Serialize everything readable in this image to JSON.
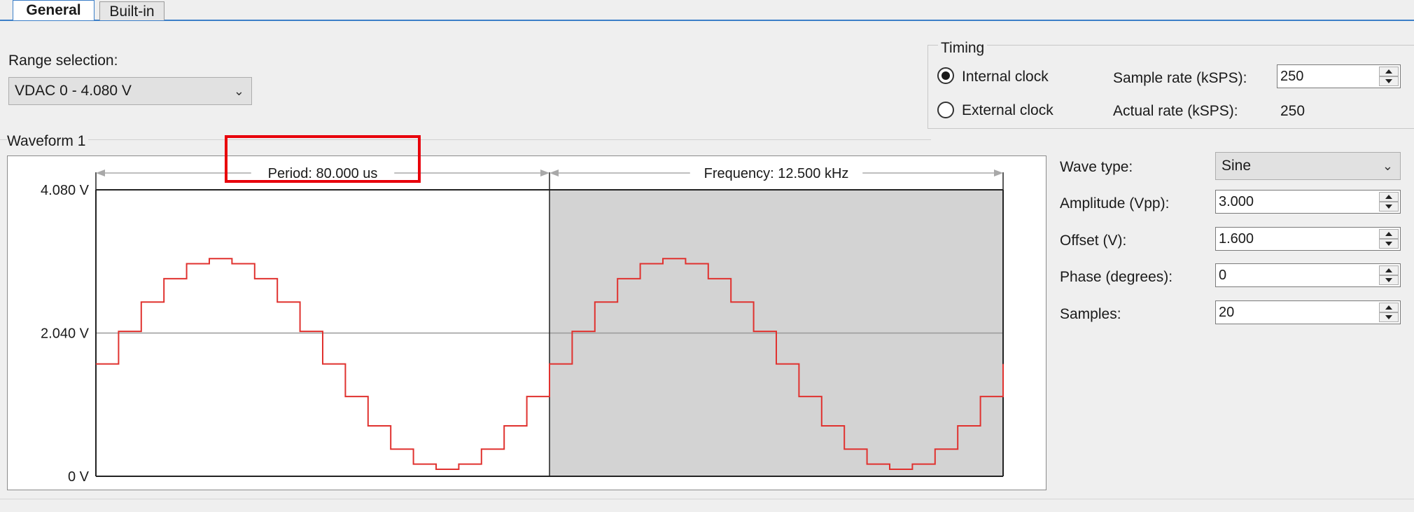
{
  "tabs": [
    {
      "label": "General",
      "active": true
    },
    {
      "label": "Built-in",
      "active": false
    }
  ],
  "range": {
    "label": "Range selection:",
    "selected": "VDAC 0 - 4.080 V"
  },
  "timing": {
    "title": "Timing",
    "internal_clock": "Internal clock",
    "external_clock": "External clock",
    "selected": "Internal clock",
    "sample_rate_label": "Sample rate (kSPS):",
    "sample_rate_value": "250",
    "actual_rate_label": "Actual rate (kSPS):",
    "actual_rate_value": "250"
  },
  "waveform": {
    "title": "Waveform 1",
    "period_label": "Period: 80.000 us",
    "frequency_label": "Frequency: 12.500 kHz",
    "y_ticks": [
      "4.080 V",
      "2.040 V",
      "0 V"
    ],
    "highlight_color": "#e8000b",
    "trace_color": "#e0322f"
  },
  "params": {
    "wave_type_label": "Wave type:",
    "wave_type_value": "Sine",
    "amplitude_label": "Amplitude (Vpp):",
    "amplitude_value": "3.000",
    "offset_label": "Offset (V):",
    "offset_value": "1.600",
    "phase_label": "Phase (degrees):",
    "phase_value": "0",
    "samples_label": "Samples:",
    "samples_value": "20"
  },
  "chart_data": {
    "type": "line",
    "x": [
      0,
      4,
      8,
      12,
      16,
      20,
      24,
      28,
      32,
      36,
      40,
      44,
      48,
      52,
      56,
      60,
      64,
      68,
      72,
      76,
      80,
      84,
      88,
      92,
      96,
      100,
      104,
      108,
      112,
      116,
      120,
      124,
      128,
      132,
      136,
      140,
      144,
      148,
      152,
      156,
      160
    ],
    "values": [
      1.6,
      2.064,
      2.482,
      2.814,
      3.027,
      3.1,
      3.027,
      2.814,
      2.482,
      2.064,
      1.6,
      1.136,
      0.718,
      0.386,
      0.173,
      0.1,
      0.173,
      0.386,
      0.718,
      1.136,
      1.6,
      2.064,
      2.482,
      2.814,
      3.027,
      3.1,
      3.027,
      2.814,
      2.482,
      2.064,
      1.6,
      1.136,
      0.718,
      0.386,
      0.173,
      0.1,
      0.173,
      0.386,
      0.718,
      1.136,
      1.6
    ],
    "ylim": [
      0,
      4.08
    ],
    "xlim": [
      0,
      160
    ],
    "y_tick_labels": [
      "4.080 V",
      "2.040 V",
      "0 V"
    ],
    "annotations": [
      "Period: 80.000 us",
      "Frequency: 12.500 kHz"
    ],
    "grid": true
  }
}
